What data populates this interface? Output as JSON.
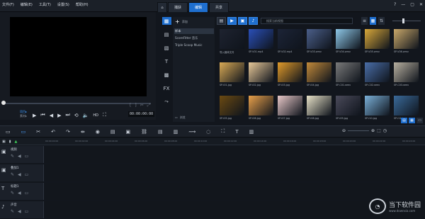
{
  "menu": [
    "文件(F)",
    "编辑(E)",
    "工具(T)",
    "设置(S)",
    "帮助(H)"
  ],
  "tabs": [
    {
      "label": "⌂"
    },
    {
      "label": "捕获"
    },
    {
      "label": "编辑",
      "active": true
    },
    {
      "label": "共享"
    }
  ],
  "window_buttons": [
    "?",
    "—",
    "▢",
    "✕"
  ],
  "player": {
    "mode_labels": [
      "项目▸",
      "素材▸"
    ],
    "timecode": "00:00:00:00"
  },
  "library": {
    "add_label": "添加",
    "items": [
      "样本",
      "ScoreFitter 音乐",
      "Triple Scoop Music"
    ],
    "browse_label": "浏览"
  },
  "media": {
    "search_placeholder": "搜索当前视图",
    "thumbnails": [
      {
        "label": "导入媒体文件",
        "color": "#1e2330"
      },
      {
        "label": "SP-V01.mp4",
        "color": "#2a4fb8"
      },
      {
        "label": "SP-V02.mp4",
        "color": "#1c2437"
      },
      {
        "label": "SP-V03.wmv",
        "color": "#4b5f8a"
      },
      {
        "label": "SP-V04.wmv",
        "color": "#8ec8e8"
      },
      {
        "label": "SP-V05.wmv",
        "color": "#d8a83a"
      },
      {
        "label": "SP-V06.wmv",
        "color": "#c9a86a"
      },
      {
        "label": "SP-I01.jpg",
        "color": "#d9aa55"
      },
      {
        "label": "SP-I02.jpg",
        "color": "#e8c898"
      },
      {
        "label": "SP-I03.jpg",
        "color": "#e09a2a"
      },
      {
        "label": "SP-I04.jpg",
        "color": "#c28a3a"
      },
      {
        "label": "SP-C01.wmv",
        "color": "#7a7a7a"
      },
      {
        "label": "SP-C02.wmv",
        "color": "#4a6ea8"
      },
      {
        "label": "SP-C03.wmv",
        "color": "#b8b0a0"
      },
      {
        "label": "SP-I05.jpg",
        "color": "#6b4a12"
      },
      {
        "label": "SP-I06.jpg",
        "color": "#e8a04a"
      },
      {
        "label": "SP-I07.jpg",
        "color": "#e8c8c8"
      },
      {
        "label": "SP-I08.jpg",
        "color": "#e8e2c8"
      },
      {
        "label": "SP-I09.jpg",
        "color": "#4a4a5a"
      },
      {
        "label": "SP-I10.jpg",
        "color": "#7ab0d8"
      },
      {
        "label": "SP-I11.jpg",
        "color": "#3a6a9a"
      }
    ]
  },
  "tracks": [
    {
      "name": "视频",
      "icon": "▣"
    },
    {
      "name": "叠加1",
      "icon": "▣"
    },
    {
      "name": "标题1",
      "icon": "T"
    },
    {
      "name": "声音",
      "icon": "♪"
    }
  ],
  "ruler": [
    "00:00:00:00",
    "00:00:02:00",
    "00:00:04:00",
    "00:00:06:00",
    "00:00:08:00",
    "00:00:10:00",
    "00:00:12:00",
    "00:00:14:00",
    "00:00:16:00",
    "00:00:18:00",
    "00:00:20:00",
    "00:00:22:00",
    "00:00:24:00"
  ],
  "watermark": {
    "main": "当下软件园",
    "sub": "www.downxia.com"
  }
}
